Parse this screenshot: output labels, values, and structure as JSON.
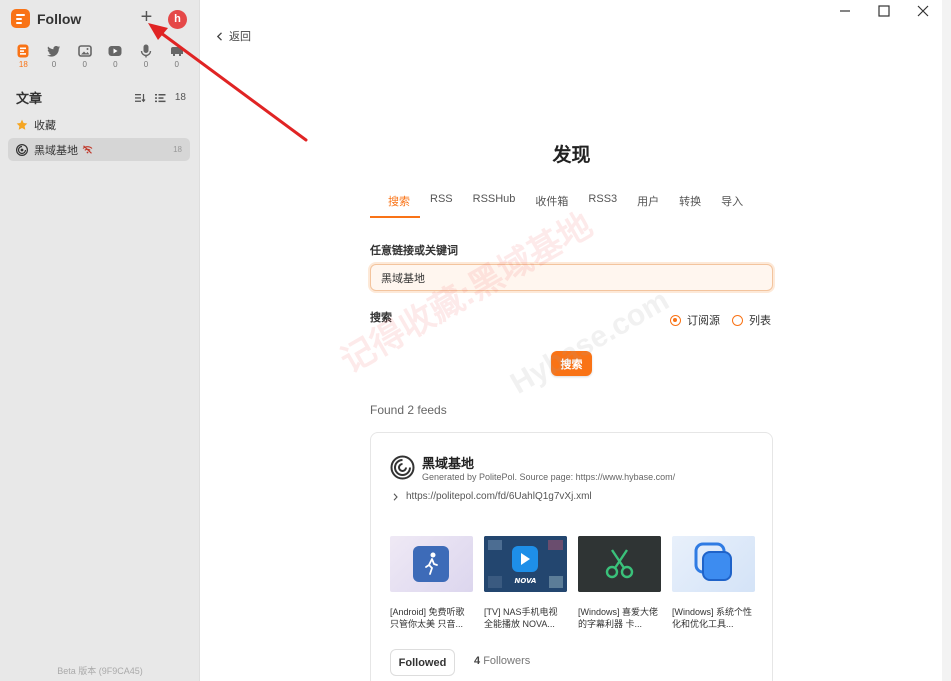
{
  "sidebar": {
    "app_name": "Follow",
    "avatar_letter": "h",
    "views": [
      {
        "icon": "article-icon",
        "count": "18",
        "active": true
      },
      {
        "icon": "twitter-icon",
        "count": "0"
      },
      {
        "icon": "picture-icon",
        "count": "0"
      },
      {
        "icon": "video-icon",
        "count": "0"
      },
      {
        "icon": "microphone-icon",
        "count": "0"
      },
      {
        "icon": "notification-icon",
        "count": "0"
      }
    ],
    "section_title": "文章",
    "section_count": "18",
    "favorites_label": "收藏",
    "feed": {
      "name": "黑域基地",
      "count": "18"
    },
    "beta_label": "Beta 版本 (9F9CA45)"
  },
  "main": {
    "back_label": "返回",
    "title": "发现",
    "tabs": [
      "搜索",
      "RSS",
      "RSSHub",
      "收件箱",
      "RSS3",
      "用户",
      "转换",
      "导入"
    ],
    "active_tab": 0,
    "field_label": "任意链接或关键词",
    "search_value": "黑域基地",
    "search_type_label": "搜索",
    "radio_options": [
      "订阅源",
      "列表"
    ],
    "search_button": "搜索",
    "found_text": "Found 2 feeds",
    "result": {
      "title": "黑域基地",
      "description": "Generated by PolitePol. Source page: https://www.hybase.com/",
      "url": "https://politepol.com/fd/6UahlQ1g7vXj.xml",
      "entries": [
        {
          "title": "[Android] 免费听歌 只管你太美 只音...",
          "thumb": "android"
        },
        {
          "title": "[TV] NAS手机电视 全能播放 NOVA...",
          "thumb": "nova"
        },
        {
          "title": "[Windows] 喜爱大佬的字幕利器 卡...",
          "thumb": "scissors"
        },
        {
          "title": "[Windows] 系统个性化和优化工具...",
          "thumb": "squares"
        }
      ],
      "followed_label": "Followed",
      "followers_count": "4",
      "followers_label": "Followers"
    }
  },
  "watermark": {
    "cn": "记得收藏:黑域基地",
    "en": "Hybase.com"
  },
  "colors": {
    "accent": "#f97316",
    "sidebar_bg": "#e8e8e8",
    "arrow": "#e02424"
  }
}
